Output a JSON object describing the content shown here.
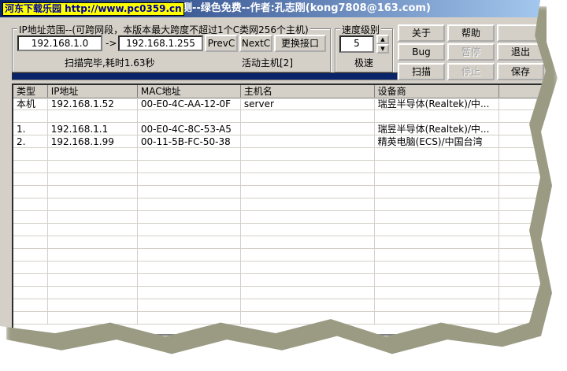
{
  "title": {
    "watermark": "河东下载乐园 http://www.pc0359.cn",
    "text": "探测--绿色免费--作者:孔志刚(kong7808@163.com)"
  },
  "range": {
    "label": "IP地址范围--(可跨网段，本版本最大跨度不超过1个C类网256个主机)",
    "start": "192.168.1.0",
    "arrow": "->",
    "end": "192.168.1.255",
    "prev": "PrevC",
    "next": "NextC",
    "switch": "更换接口",
    "status": "扫描完毕,耗时1.63秒",
    "active": "活动主机[2]"
  },
  "speed": {
    "label": "速度级别",
    "value": "5",
    "mode": "极速"
  },
  "buttons": {
    "about": "关于",
    "help": "帮助",
    "bug": "Bug",
    "pause": "暂停",
    "exit": "退出",
    "scan": "扫描",
    "stop": "停止",
    "save": "保存"
  },
  "progress": 1.0,
  "table": {
    "headers": [
      "类型",
      "IP地址",
      "MAC地址",
      "主机名",
      "设备商"
    ],
    "rows": [
      [
        "本机",
        "192.168.1.52",
        "00-E0-4C-AA-12-0F",
        "server",
        "瑞昱半导体(Realtek)/中..."
      ],
      [
        "",
        "",
        "",
        "",
        ""
      ],
      [
        "1.",
        "192.168.1.1",
        "00-E0-4C-8C-53-A5",
        "",
        "瑞昱半导体(Realtek)/中..."
      ],
      [
        "2.",
        "192.168.1.99",
        "00-11-5B-FC-50-38",
        "",
        "精英电脑(ECS)/中国台湾"
      ]
    ]
  }
}
